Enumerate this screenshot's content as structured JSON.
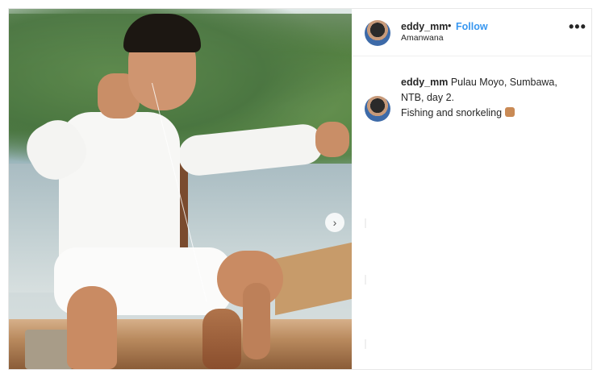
{
  "post": {
    "username": "eddy_mm",
    "separator": "•",
    "follow_label": "Follow",
    "location": "Amanwana",
    "more_label": "•••",
    "caption": {
      "username": "eddy_mm",
      "text_line1": "Pulau Moyo, Sumbawa, NTB, day 2.",
      "text_line2": "Fishing and snorkeling",
      "emoji": "thumbs-up-icon"
    },
    "media": {
      "next_arrow": "›"
    }
  }
}
